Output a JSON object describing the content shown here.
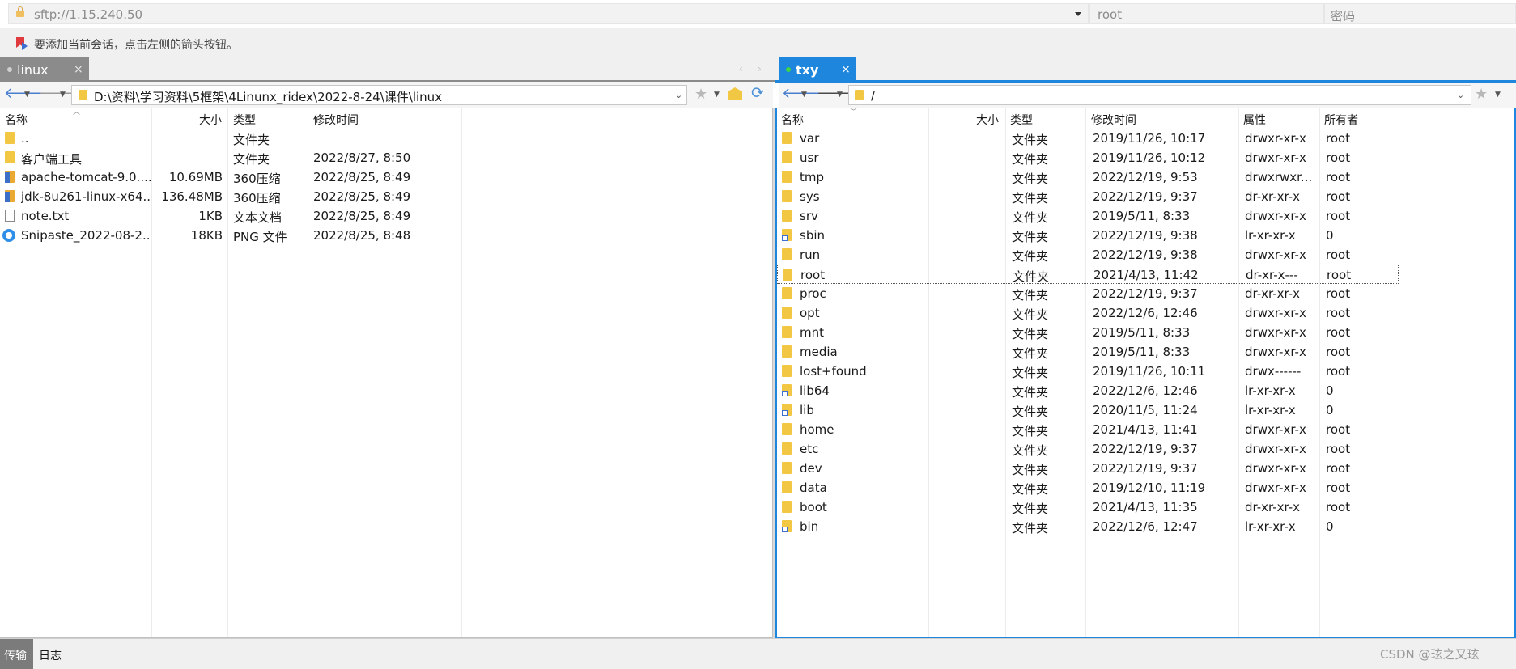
{
  "connection": {
    "address_placeholder": "sftp://1.15.240.50",
    "user_placeholder": "root",
    "password_placeholder": "密码",
    "hint": "要添加当前会话，点击左侧的箭头按钮。"
  },
  "tabs": {
    "local": {
      "label": "linux",
      "close": "×"
    },
    "remote": {
      "label": "txy",
      "close": "×"
    },
    "scroll_left": "‹",
    "scroll_right": "›"
  },
  "icons": {
    "back": "🡐",
    "forward": "🡒",
    "dropdown": "▼",
    "star": "★",
    "refresh": "⟳",
    "caret": "⌄"
  },
  "local": {
    "path": "D:\\资料\\学习资料\\5框架\\4Linunx_ridex\\2022-8-24\\课件\\linux",
    "columns": {
      "name": "名称",
      "size": "大小",
      "type": "类型",
      "modified": "修改时间"
    },
    "files": [
      {
        "icon": "folder",
        "name": "..",
        "size": "",
        "type": "文件夹",
        "modified": ""
      },
      {
        "icon": "folder",
        "name": "客户端工具",
        "size": "",
        "type": "文件夹",
        "modified": "2022/8/27, 8:50"
      },
      {
        "icon": "zip",
        "name": "apache-tomcat-9.0....",
        "size": "10.69MB",
        "type": "360压缩",
        "modified": "2022/8/25, 8:49"
      },
      {
        "icon": "zip",
        "name": "jdk-8u261-linux-x64...",
        "size": "136.48MB",
        "type": "360压缩",
        "modified": "2022/8/25, 8:49"
      },
      {
        "icon": "text",
        "name": "note.txt",
        "size": "1KB",
        "type": "文本文档",
        "modified": "2022/8/25, 8:49"
      },
      {
        "icon": "image",
        "name": "Snipaste_2022-08-2...",
        "size": "18KB",
        "type": "PNG 文件",
        "modified": "2022/8/25, 8:48"
      }
    ]
  },
  "remote": {
    "path": "/",
    "columns": {
      "name": "名称",
      "size": "大小",
      "type": "类型",
      "modified": "修改时间",
      "perms": "属性",
      "owner": "所有者"
    },
    "selected_index": 7,
    "files": [
      {
        "icon": "folder",
        "name": "var",
        "size": "",
        "type": "文件夹",
        "modified": "2019/11/26, 10:17",
        "perms": "drwxr-xr-x",
        "owner": "root"
      },
      {
        "icon": "folder",
        "name": "usr",
        "size": "",
        "type": "文件夹",
        "modified": "2019/11/26, 10:12",
        "perms": "drwxr-xr-x",
        "owner": "root"
      },
      {
        "icon": "folder",
        "name": "tmp",
        "size": "",
        "type": "文件夹",
        "modified": "2022/12/19, 9:53",
        "perms": "drwxrwxr...",
        "owner": "root"
      },
      {
        "icon": "folder",
        "name": "sys",
        "size": "",
        "type": "文件夹",
        "modified": "2022/12/19, 9:37",
        "perms": "dr-xr-xr-x",
        "owner": "root"
      },
      {
        "icon": "folder",
        "name": "srv",
        "size": "",
        "type": "文件夹",
        "modified": "2019/5/11, 8:33",
        "perms": "drwxr-xr-x",
        "owner": "root"
      },
      {
        "icon": "link",
        "name": "sbin",
        "size": "",
        "type": "文件夹",
        "modified": "2022/12/19, 9:38",
        "perms": "lr-xr-xr-x",
        "owner": "0"
      },
      {
        "icon": "folder",
        "name": "run",
        "size": "",
        "type": "文件夹",
        "modified": "2022/12/19, 9:38",
        "perms": "drwxr-xr-x",
        "owner": "root"
      },
      {
        "icon": "folder",
        "name": "root",
        "size": "",
        "type": "文件夹",
        "modified": "2021/4/13, 11:42",
        "perms": "dr-xr-x---",
        "owner": "root"
      },
      {
        "icon": "folder",
        "name": "proc",
        "size": "",
        "type": "文件夹",
        "modified": "2022/12/19, 9:37",
        "perms": "dr-xr-xr-x",
        "owner": "root"
      },
      {
        "icon": "folder",
        "name": "opt",
        "size": "",
        "type": "文件夹",
        "modified": "2022/12/6, 12:46",
        "perms": "drwxr-xr-x",
        "owner": "root"
      },
      {
        "icon": "folder",
        "name": "mnt",
        "size": "",
        "type": "文件夹",
        "modified": "2019/5/11, 8:33",
        "perms": "drwxr-xr-x",
        "owner": "root"
      },
      {
        "icon": "folder",
        "name": "media",
        "size": "",
        "type": "文件夹",
        "modified": "2019/5/11, 8:33",
        "perms": "drwxr-xr-x",
        "owner": "root"
      },
      {
        "icon": "folder",
        "name": "lost+found",
        "size": "",
        "type": "文件夹",
        "modified": "2019/11/26, 10:11",
        "perms": "drwx------",
        "owner": "root"
      },
      {
        "icon": "link",
        "name": "lib64",
        "size": "",
        "type": "文件夹",
        "modified": "2022/12/6, 12:46",
        "perms": "lr-xr-xr-x",
        "owner": "0"
      },
      {
        "icon": "link",
        "name": "lib",
        "size": "",
        "type": "文件夹",
        "modified": "2020/11/5, 11:24",
        "perms": "lr-xr-xr-x",
        "owner": "0"
      },
      {
        "icon": "folder",
        "name": "home",
        "size": "",
        "type": "文件夹",
        "modified": "2021/4/13, 11:41",
        "perms": "drwxr-xr-x",
        "owner": "root"
      },
      {
        "icon": "folder",
        "name": "etc",
        "size": "",
        "type": "文件夹",
        "modified": "2022/12/19, 9:37",
        "perms": "drwxr-xr-x",
        "owner": "root"
      },
      {
        "icon": "folder",
        "name": "dev",
        "size": "",
        "type": "文件夹",
        "modified": "2022/12/19, 9:37",
        "perms": "drwxr-xr-x",
        "owner": "root"
      },
      {
        "icon": "folder",
        "name": "data",
        "size": "",
        "type": "文件夹",
        "modified": "2019/12/10, 11:19",
        "perms": "drwxr-xr-x",
        "owner": "root"
      },
      {
        "icon": "folder",
        "name": "boot",
        "size": "",
        "type": "文件夹",
        "modified": "2021/4/13, 11:35",
        "perms": "dr-xr-xr-x",
        "owner": "root"
      },
      {
        "icon": "link",
        "name": "bin",
        "size": "",
        "type": "文件夹",
        "modified": "2022/12/6, 12:47",
        "perms": "lr-xr-xr-x",
        "owner": "0"
      }
    ]
  },
  "bottom": {
    "transfer_label": "传输",
    "log_label": "日志"
  },
  "watermark": "CSDN @玹之又玹",
  "colors": {
    "accent": "#1e86dc",
    "tab_inactive": "#8b8b8b",
    "folder": "#f2c744"
  }
}
